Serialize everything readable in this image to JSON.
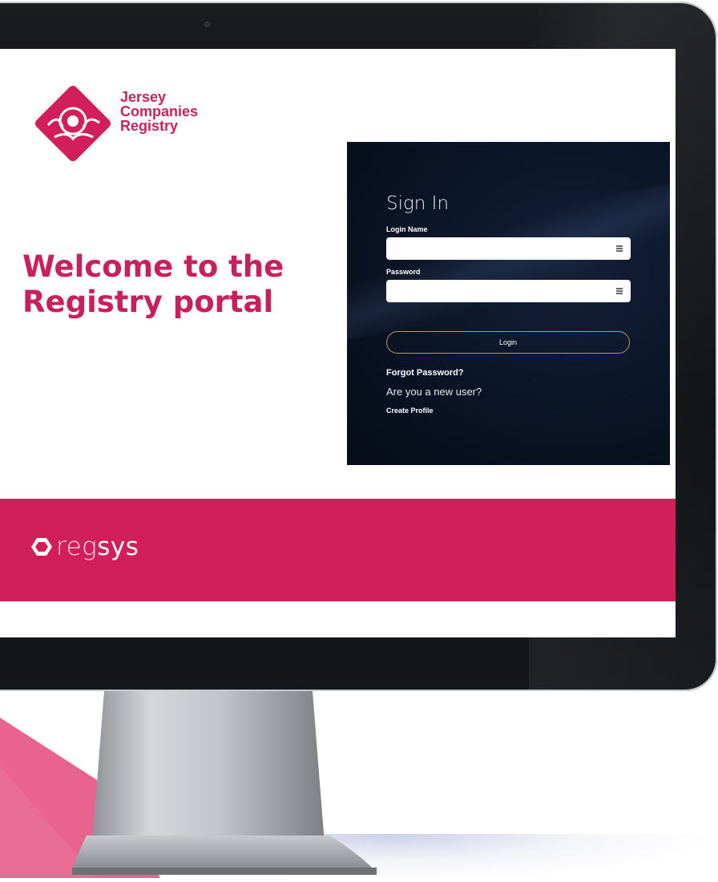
{
  "brand": {
    "logo_line1": "Jersey",
    "logo_line2": "Companies",
    "logo_line3": "Registry",
    "color": "#d21f5b"
  },
  "welcome": {
    "line1": "Welcome to the",
    "line2": "Registry portal"
  },
  "signin": {
    "title": "Sign In",
    "login_name_label": "Login Name",
    "login_name_value": "",
    "password_label": "Password",
    "password_value": "",
    "login_button": "Login",
    "forgot_password": "Forgot Password?",
    "new_user_prompt": "Are you a new user?",
    "create_profile": "Create Profile",
    "field_icon": "keyboard-icon"
  },
  "footer": {
    "product_light": "reg",
    "product_bold": "sys",
    "icon": "hexagon-icon"
  }
}
